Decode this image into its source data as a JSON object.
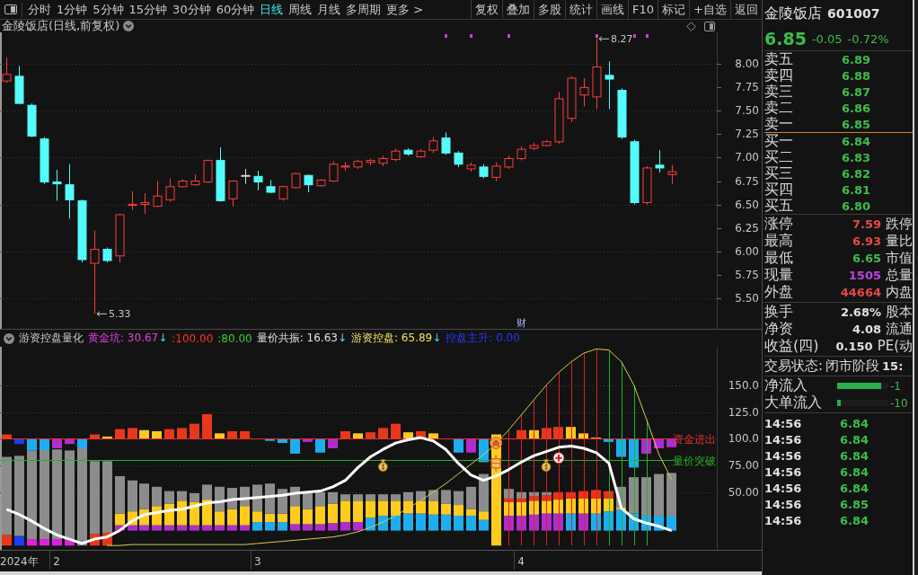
{
  "toolbar": {
    "tabs": [
      {
        "label": "分时",
        "selected": false
      },
      {
        "label": "1分钟",
        "selected": false
      },
      {
        "label": "5分钟",
        "selected": false
      },
      {
        "label": "15分钟",
        "selected": false
      },
      {
        "label": "30分钟",
        "selected": false
      },
      {
        "label": "60分钟",
        "selected": false
      },
      {
        "label": "日线",
        "selected": true
      },
      {
        "label": "周线",
        "selected": false
      },
      {
        "label": "月线",
        "selected": false
      },
      {
        "label": "多周期",
        "selected": false
      },
      {
        "label": "更多 >",
        "selected": false
      }
    ],
    "buttons": [
      "复权",
      "叠加",
      "多股",
      "统计",
      "画线",
      "F10",
      "标记",
      "+自选",
      "返回"
    ]
  },
  "main_chart": {
    "title": "金陵饭店(日线,前复权)",
    "chart_data": {
      "type": "candlestick",
      "ylim": [
        5.17,
        8.34
      ],
      "grid": true,
      "categories": [
        null,
        null,
        null,
        null,
        null,
        null,
        null,
        null,
        null,
        null,
        null,
        null,
        null,
        null,
        null,
        null,
        null,
        null,
        null,
        null,
        null,
        null,
        null,
        null,
        null,
        null,
        null,
        null,
        null,
        null,
        null,
        null,
        null,
        null,
        null,
        null,
        null,
        null,
        null,
        null,
        null,
        "财",
        null,
        null,
        null,
        null,
        null,
        null,
        null,
        null,
        null,
        null,
        null,
        null
      ],
      "yticks": [
        {
          "value": 5.5,
          "label": "5.50"
        },
        {
          "value": 5.75,
          "label": "5.75"
        },
        {
          "value": 6,
          "label": "6.00"
        },
        {
          "value": 6.25,
          "label": "6.25"
        },
        {
          "value": 6.5,
          "label": "6.50"
        },
        {
          "value": 6.75,
          "label": "6.75"
        },
        {
          "value": 7,
          "label": "7.00"
        },
        {
          "value": 7.25,
          "label": "7.25"
        },
        {
          "value": 7.5,
          "label": "7.50"
        },
        {
          "value": 7.75,
          "label": "7.75"
        },
        {
          "value": 8,
          "label": "8.00"
        }
      ],
      "ohlc": [
        [
          7.82,
          8.07,
          7.8,
          7.89
        ],
        [
          7.87,
          7.98,
          7.57,
          7.58
        ],
        [
          7.56,
          7.58,
          7.22,
          7.23
        ],
        [
          7.2,
          7.22,
          6.72,
          6.74
        ],
        [
          6.74,
          6.87,
          6.54,
          6.72
        ],
        [
          6.71,
          6.93,
          6.35,
          6.55
        ],
        [
          6.54,
          6.55,
          5.88,
          5.91
        ],
        [
          5.87,
          6.22,
          5.33,
          6.02
        ],
        [
          6.02,
          6.04,
          5.88,
          5.9
        ],
        [
          5.95,
          6.4,
          5.88,
          6.39
        ],
        [
          6.49,
          6.64,
          6.44,
          6.5
        ],
        [
          6.5,
          6.62,
          6.4,
          6.52
        ],
        [
          6.48,
          6.75,
          6.47,
          6.59
        ],
        [
          6.55,
          6.78,
          6.53,
          6.69
        ],
        [
          6.69,
          6.77,
          6.68,
          6.75
        ],
        [
          6.71,
          6.82,
          6.7,
          6.75
        ],
        [
          6.74,
          6.98,
          6.73,
          6.97
        ],
        [
          6.97,
          7.11,
          6.53,
          6.54
        ],
        [
          6.56,
          6.76,
          6.48,
          6.75
        ],
        [
          6.81,
          6.88,
          6.72,
          6.81
        ],
        [
          6.8,
          6.86,
          6.65,
          6.74
        ],
        [
          6.69,
          6.76,
          6.62,
          6.63
        ],
        [
          6.56,
          6.7,
          6.54,
          6.69
        ],
        [
          6.68,
          6.84,
          6.67,
          6.83
        ],
        [
          6.81,
          6.82,
          6.63,
          6.71
        ],
        [
          6.7,
          6.77,
          6.69,
          6.76
        ],
        [
          6.75,
          6.96,
          6.74,
          6.93
        ],
        [
          6.9,
          6.95,
          6.86,
          6.91
        ],
        [
          6.9,
          6.98,
          6.88,
          6.96
        ],
        [
          6.95,
          6.99,
          6.92,
          6.97
        ],
        [
          6.94,
          7.02,
          6.91,
          6.99
        ],
        [
          6.98,
          7.1,
          6.96,
          7.07
        ],
        [
          7.08,
          7.1,
          7.02,
          7.04
        ],
        [
          7.01,
          7.09,
          7.0,
          7.07
        ],
        [
          7.08,
          7.22,
          7.05,
          7.18
        ],
        [
          7.21,
          7.27,
          7.03,
          7.05
        ],
        [
          7.05,
          7.07,
          6.9,
          6.93
        ],
        [
          6.88,
          6.95,
          6.85,
          6.92
        ],
        [
          6.9,
          6.93,
          6.78,
          6.8
        ],
        [
          6.79,
          6.95,
          6.75,
          6.91
        ],
        [
          6.9,
          7.02,
          6.88,
          6.99
        ],
        [
          6.99,
          7.12,
          6.97,
          7.09
        ],
        [
          7.1,
          7.16,
          7.08,
          7.13
        ],
        [
          7.13,
          7.19,
          7.12,
          7.17
        ],
        [
          7.17,
          7.7,
          7.15,
          7.63
        ],
        [
          7.42,
          7.87,
          7.38,
          7.85
        ],
        [
          7.67,
          7.85,
          7.55,
          7.75
        ],
        [
          7.65,
          8.27,
          7.52,
          7.97
        ],
        [
          7.88,
          8.03,
          7.52,
          7.84
        ],
        [
          7.72,
          7.74,
          7.2,
          7.22
        ],
        [
          7.17,
          7.19,
          6.5,
          6.52
        ],
        [
          6.52,
          6.91,
          6.5,
          6.89
        ],
        [
          6.92,
          7.08,
          6.84,
          6.89
        ],
        [
          6.82,
          6.92,
          6.72,
          6.85
        ]
      ],
      "series": [
        {
          "type": "scatter",
          "marker": "square",
          "color": "#d040d0",
          "values": [
            null,
            null,
            null,
            null,
            null,
            null,
            null,
            null,
            null,
            null,
            null,
            null,
            null,
            null,
            null,
            null,
            null,
            null,
            null,
            null,
            null,
            null,
            null,
            null,
            null,
            null,
            null,
            null,
            null,
            null,
            null,
            null,
            null,
            null,
            null,
            8.3,
            null,
            8.3,
            null,
            null,
            8.3,
            null,
            null,
            null,
            null,
            null,
            null,
            8.3,
            null,
            null,
            8.3,
            8.3,
            null,
            null
          ]
        }
      ],
      "annotations": [
        "8.27",
        "5.33"
      ]
    }
  },
  "indicator": {
    "name": "游资控盘量化",
    "items": [
      {
        "text": "黄金坑: 30.67",
        "arrow": "↓",
        "color": "#e040e0"
      },
      {
        "text": ":100.00",
        "color": "#ff3030"
      },
      {
        "text": ":80.00",
        "color": "#30d030"
      },
      {
        "text": "量价共振: 16.63",
        "arrow": "↓",
        "color": "#e0e0e0"
      },
      {
        "text": "游资控盘: 65.89",
        "arrow": "↓",
        "color": "#f0e060"
      },
      {
        "text": "控盘主升: 0.00",
        "color": "#2838ff"
      }
    ],
    "chart_data": {
      "type": "bar",
      "ylim": [
        -4,
        186
      ],
      "grid": true,
      "categories": [
        null,
        "2024年",
        null,
        null,
        "2",
        null,
        null,
        null,
        null,
        null,
        null,
        null,
        null,
        null,
        null,
        null,
        null,
        null,
        null,
        null,
        "3",
        null,
        null,
        null,
        null,
        null,
        null,
        null,
        null,
        null,
        null,
        null,
        null,
        null,
        null,
        null,
        null,
        null,
        null,
        null,
        null,
        "4",
        null,
        null,
        null,
        null,
        null,
        null,
        null,
        null,
        null,
        null,
        null,
        null
      ],
      "yticks": [
        {
          "value": 50,
          "label": "50.00"
        },
        {
          "value": 75,
          "label": "75.00"
        },
        {
          "value": 100,
          "label": "100.0"
        },
        {
          "value": 125,
          "label": "125.0"
        },
        {
          "value": 150,
          "label": "150.0"
        }
      ],
      "ref_lines": [
        {
          "axis": "y",
          "value": 100,
          "label": "资金进出",
          "color": "#e83030"
        },
        {
          "axis": "y",
          "value": 80,
          "label": "量价突破",
          "color": "#22b422"
        }
      ],
      "series": [
        {
          "type": "bar",
          "base": [
            0,
            0,
            0,
            0,
            0,
            0,
            null,
            0,
            0,
            14,
            14,
            14,
            14,
            14,
            14,
            14,
            14,
            14,
            14,
            14,
            14,
            14,
            14,
            14,
            14,
            14,
            14,
            14,
            14,
            14,
            14,
            14,
            14,
            14,
            14,
            14,
            14,
            14,
            14,
            null,
            14,
            14,
            14,
            14,
            14,
            14,
            14,
            14,
            14,
            14,
            14,
            14,
            14,
            14
          ],
          "values": [
            10,
            9,
            6,
            6,
            6,
            5,
            null,
            11,
            12,
            5,
            5,
            5,
            5,
            5,
            5,
            5,
            5,
            5,
            5,
            5,
            8,
            8,
            8,
            6,
            6,
            6,
            7,
            8,
            8,
            12,
            14,
            14,
            16,
            16,
            15,
            15,
            14,
            14,
            10,
            null,
            14,
            14,
            15,
            16,
            16,
            16,
            16,
            16,
            18,
            20,
            16,
            14,
            14,
            14
          ],
          "colors": [
            "#e8381c",
            "#1e3cf0",
            "#e020e0",
            "#e020e0",
            "#e020e0",
            "#e020e0",
            null,
            "#e8381c",
            "#e8381c",
            "#b02cd0",
            "#b02cd0",
            "#b02cd0",
            "#b02cd0",
            "#b02cd0",
            "#b02cd0",
            "#b02cd0",
            "#b02cd0",
            "#b02cd0",
            "#b02cd0",
            "#b02cd0",
            "#1eaef0",
            "#1eaef0",
            "#1eaef0",
            "#b02cd0",
            "#b02cd0",
            "#b02cd0",
            "#b02cd0",
            "#b02cd0",
            "#b02cd0",
            "#1eaef0",
            "#1eaef0",
            "#1eaef0",
            "#1eaef0",
            "#1eaef0",
            "#1eaef0",
            "#1eaef0",
            "#1eaef0",
            "#1eaef0",
            "#1eaef0",
            null,
            "#b02cd0",
            "#b02cd0",
            "#b02cd0",
            "#b02cd0",
            "#b02cd0",
            "#1eaef0",
            "#b02cd0",
            "#1eaef0",
            "#1eaef0",
            "#1eaef0",
            "#1eaef0",
            "#1eaef0",
            "#1eaef0",
            "#1eaef0"
          ]
        },
        {
          "type": "bar",
          "color": "#ffcc1e",
          "base": [
            null,
            null,
            null,
            null,
            null,
            null,
            null,
            null,
            null,
            19,
            19,
            19,
            19,
            19,
            19,
            19,
            19,
            19,
            19,
            19,
            22,
            22,
            22,
            20,
            20,
            20,
            21,
            22,
            22,
            26,
            28,
            28,
            30,
            30,
            29,
            29,
            28,
            28,
            24,
            0,
            28,
            28,
            29,
            30,
            30,
            30,
            30,
            30,
            32,
            34,
            null,
            null,
            null,
            null
          ],
          "values": [
            null,
            null,
            null,
            null,
            null,
            null,
            null,
            null,
            null,
            11,
            13,
            15,
            18,
            20,
            23,
            22,
            24,
            13,
            15,
            18,
            10,
            8,
            8,
            17,
            14,
            17,
            18,
            20,
            20,
            16,
            14,
            14,
            12,
            12,
            13,
            10,
            10,
            6,
            8,
            104,
            13,
            13,
            13,
            12,
            13,
            14,
            14,
            14,
            12,
            2,
            null,
            null,
            null,
            null
          ]
        },
        {
          "type": "bar",
          "color": "#f03018",
          "base": [
            null,
            null,
            null,
            null,
            null,
            null,
            null,
            null,
            null,
            null,
            null,
            null,
            null,
            null,
            null,
            null,
            null,
            null,
            null,
            null,
            null,
            null,
            null,
            null,
            null,
            null,
            null,
            null,
            null,
            null,
            null,
            null,
            null,
            null,
            null,
            null,
            null,
            null,
            null,
            null,
            41,
            41,
            42,
            42,
            43,
            44,
            44,
            44,
            44,
            null,
            null,
            null,
            null,
            null
          ],
          "values": [
            null,
            null,
            null,
            null,
            null,
            null,
            null,
            null,
            null,
            null,
            null,
            null,
            null,
            null,
            null,
            null,
            null,
            null,
            null,
            null,
            null,
            null,
            null,
            null,
            null,
            null,
            null,
            null,
            null,
            null,
            null,
            null,
            null,
            null,
            null,
            null,
            null,
            null,
            null,
            null,
            3,
            3,
            4,
            5,
            7,
            6,
            7,
            8,
            7,
            null,
            null,
            null,
            null,
            null
          ]
        },
        {
          "type": "bar",
          "color": "#8c8c8c",
          "base": [
            10,
            9,
            6,
            6,
            6,
            5,
            0,
            11,
            12,
            30,
            32,
            34,
            37,
            39,
            42,
            41,
            43,
            32,
            34,
            37,
            32,
            30,
            30,
            37,
            34,
            37,
            39,
            42,
            42,
            42,
            42,
            42,
            42,
            42,
            42,
            39,
            38,
            34,
            32,
            null,
            44,
            44,
            46,
            47,
            null,
            null,
            null,
            null,
            null,
            36,
            30,
            28,
            28,
            28
          ],
          "values": [
            73,
            75,
            83,
            84,
            84,
            84,
            91,
            68,
            67,
            35,
            29,
            24,
            18,
            12,
            9,
            8,
            14,
            23,
            20,
            18,
            25,
            28,
            23,
            18,
            16,
            13,
            11,
            6,
            6,
            6,
            6,
            6,
            8,
            9,
            10,
            13,
            13,
            21,
            35,
            null,
            9,
            6,
            4,
            3,
            null,
            null,
            null,
            null,
            null,
            19,
            34,
            36,
            39,
            40
          ]
        },
        {
          "type": "bar",
          "base": [
            100,
            95,
            89,
            89,
            91,
            95,
            91,
            100,
            100,
            100,
            100,
            100,
            100,
            100,
            100,
            100,
            100,
            100,
            100,
            100,
            null,
            98,
            96,
            86,
            97,
            87,
            91,
            100,
            100,
            100,
            100,
            100,
            100,
            100,
            100,
            null,
            87,
            87,
            78,
            null,
            null,
            100,
            100,
            100,
            100,
            100,
            100,
            100,
            97,
            83,
            73,
            86,
            91,
            92
          ],
          "values": [
            4,
            5,
            11,
            11,
            9,
            5,
            9,
            4,
            2,
            9,
            10,
            8,
            7,
            9,
            10,
            14,
            23,
            5,
            7,
            7,
            null,
            2,
            4,
            14,
            3,
            13,
            9,
            7,
            5,
            6,
            10,
            14,
            6,
            7,
            5,
            null,
            13,
            13,
            22,
            null,
            null,
            8,
            8,
            10,
            11,
            11,
            5,
            1,
            3,
            17,
            27,
            14,
            9,
            8
          ],
          "colors": [
            "#e8381c",
            "#1e3cf0",
            "#1eaef0",
            "#1eaef0",
            "#b02cd0",
            "#b02cd0",
            "#1eaef0",
            "#e8381c",
            "#ffc81e",
            "#e8381c",
            "#e8381c",
            "#ffc81e",
            "#ffc81e",
            "#e8381c",
            "#e8381c",
            "#e8381c",
            "#e8381c",
            "#ffc81e",
            "#e8381c",
            "#e8381c",
            null,
            "#1eaef0",
            "#1eaef0",
            "#1eaef0",
            "#b02cd0",
            "#1eaef0",
            "#b02cd0",
            "#e8381c",
            "#ffc81e",
            "#e8381c",
            "#e8381c",
            "#e8381c",
            "#ffc81e",
            "#e8381c",
            "#ffc81e",
            null,
            "#1eaef0",
            "#b02cd0",
            "#1eaef0",
            null,
            null,
            "#e8381c",
            "#ffc81e",
            "#e8381c",
            "#e8381c",
            "#ffc81e",
            "#ffc81e",
            "#ffc81e",
            "#1eaef0",
            "#1eaef0",
            "#1eaef0",
            "#b02cd0",
            "#b02cd0",
            "#b02cd0"
          ]
        },
        {
          "type": "line",
          "color": "#d8cc50",
          "values": [
            null,
            null,
            null,
            null,
            null,
            null,
            null,
            null,
            0,
            0,
            1,
            1,
            1,
            1,
            1,
            1,
            1,
            1,
            1,
            1,
            2,
            3,
            4,
            5,
            6,
            7,
            8,
            10,
            13,
            17,
            22,
            28,
            35,
            42,
            50,
            58,
            67,
            76,
            85,
            95,
            108,
            122,
            136,
            150,
            162,
            172,
            180,
            184,
            183,
            172,
            150,
            118,
            85,
            62
          ]
        },
        {
          "type": "line",
          "color": "#ffffff",
          "values": [
            34,
            29,
            23,
            16,
            10,
            6,
            2,
            6,
            8,
            14,
            23,
            29,
            31,
            33,
            34,
            37,
            40,
            41,
            43,
            44,
            45,
            46,
            47,
            49,
            50,
            51,
            55,
            61,
            73,
            83,
            90,
            96,
            99,
            101,
            98,
            90,
            77,
            66,
            61,
            65,
            71,
            78,
            84,
            88,
            92,
            93,
            91,
            87,
            77,
            35,
            25,
            21,
            18,
            14
          ]
        }
      ]
    }
  },
  "quote_panel": {
    "name": "金陵饭店",
    "code": "601007",
    "price": "6.85",
    "change": "-0.05",
    "change_percent": "-0.72%",
    "asks": [
      {
        "label": "卖五",
        "price": "6.89"
      },
      {
        "label": "卖四",
        "price": "6.88"
      },
      {
        "label": "卖三",
        "price": "6.87"
      },
      {
        "label": "卖二",
        "price": "6.86"
      },
      {
        "label": "卖一",
        "price": "6.85"
      }
    ],
    "bids": [
      {
        "label": "买一",
        "price": "6.84"
      },
      {
        "label": "买二",
        "price": "6.83"
      },
      {
        "label": "买三",
        "price": "6.82"
      },
      {
        "label": "买四",
        "price": "6.81"
      },
      {
        "label": "买五",
        "price": "6.80"
      }
    ],
    "stats": [
      {
        "label": "涨停",
        "value": "7.59",
        "color": "#e84848",
        "right_label": "跌停"
      },
      {
        "label": "最高",
        "value": "6.93",
        "color": "#e84848",
        "right_label": "量比"
      },
      {
        "label": "最低",
        "value": "6.65",
        "color": "#3cbc4c",
        "right_label": "市值"
      },
      {
        "label": "现量",
        "value": "1505",
        "color": "#c040e0",
        "right_label": "总量"
      },
      {
        "label": "外盘",
        "value": "44664",
        "color": "#e84848",
        "right_label": "内盘"
      }
    ],
    "fundamentals": [
      {
        "label": "换手",
        "value": "2.68%",
        "right_label": "股本"
      },
      {
        "label": "净资",
        "value": "4.08",
        "right_label": "流通"
      },
      {
        "label": "收益(四)",
        "value": "0.150",
        "right_label": "PE(动"
      }
    ],
    "status": {
      "label": "交易状态:",
      "value": "闭市阶段",
      "time": "15:"
    },
    "flows": [
      {
        "label": "净流入",
        "level": 0.86,
        "value": "-1"
      },
      {
        "label": "大单流入",
        "level": 0.07,
        "value": "-10"
      }
    ],
    "ticks": [
      {
        "time": "14:56",
        "price": "6.84"
      },
      {
        "time": "14:56",
        "price": "6.84"
      },
      {
        "time": "14:56",
        "price": "6.84"
      },
      {
        "time": "14:56",
        "price": "6.84"
      },
      {
        "time": "14:56",
        "price": "6.84"
      },
      {
        "time": "14:56",
        "price": "6.85"
      },
      {
        "time": "14:56",
        "price": "6.84"
      }
    ]
  }
}
